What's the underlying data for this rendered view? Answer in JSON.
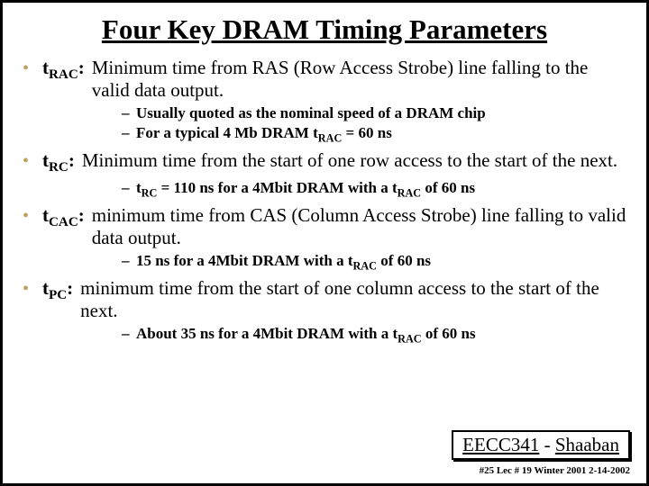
{
  "title": "Four Key DRAM Timing Parameters",
  "params": [
    {
      "term_html": "t<span class='sub'>RAC</span>:",
      "def": "Minimum time from RAS (Row Access Strobe) line falling to the valid data output.",
      "subs": [
        "Usually quoted as the nominal speed of a DRAM chip",
        "For a typical 4 Mb DRAM t<span class='sub'>RAC</span>  = 60 ns"
      ]
    },
    {
      "term_html": "t<span class='sub'>RC</span>:",
      "def": "Minimum time from the start of one row access to the start of the next.",
      "subs": [
        "t<span class='sub'>RC</span>  = 110 ns for a 4Mbit DRAM with a t<span class='sub'>RAC</span> of 60 ns"
      ]
    },
    {
      "term_html": "t<span class='sub'>CAC</span>:",
      "def": "minimum time from CAS (Column Access Strobe) line falling to valid data output.",
      "subs": [
        "15 ns for a 4Mbit DRAM with a t<span class='sub'>RAC</span> of 60 ns"
      ]
    },
    {
      "term_html": "t<span class='sub'>PC</span>:",
      "def": "minimum time from the start of one column access to the start of the next.",
      "subs": [
        "About 35 ns for a 4Mbit DRAM with a t<span class='sub'>RAC</span> of 60 ns"
      ]
    }
  ],
  "footer": {
    "course": "EECC341",
    "dash": " - ",
    "author": "Shaaban",
    "small": "#25  Lec # 19  Winter 2001  2-14-2002"
  }
}
